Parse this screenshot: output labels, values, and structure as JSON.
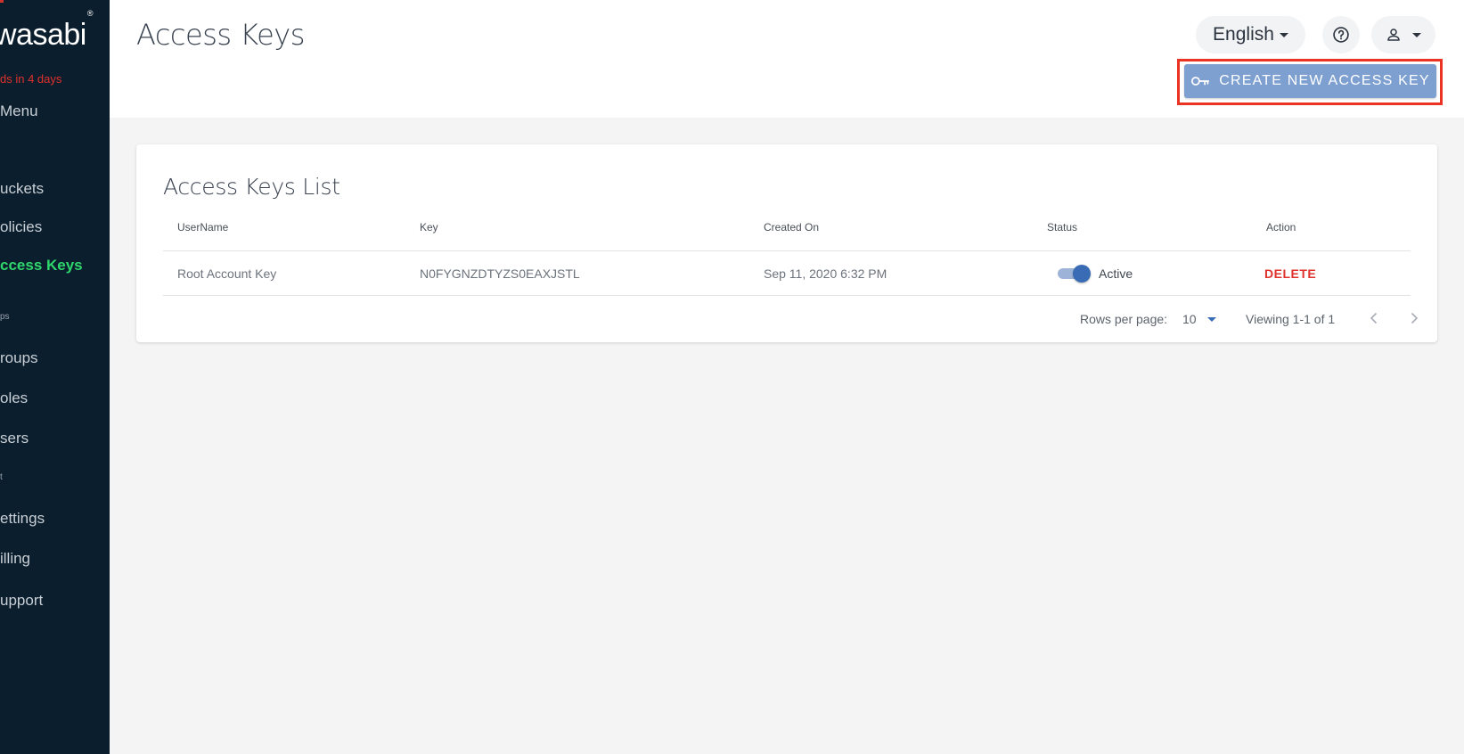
{
  "sidebar": {
    "logo": "wasabi",
    "logo_mark": "®",
    "trial_notice": "ds in 4 days",
    "menu_label": "Menu",
    "items": [
      {
        "label": "Buckets",
        "visible_text": "uckets"
      },
      {
        "label": "Policies",
        "visible_text": "olicies"
      },
      {
        "label": "Access Keys",
        "visible_text": "ccess Keys",
        "active": true
      },
      {
        "label": "Groups",
        "visible_text": "roups"
      },
      {
        "label": "Roles",
        "visible_text": "oles"
      },
      {
        "label": "Users",
        "visible_text": "sers"
      },
      {
        "label": "Settings",
        "visible_text": "ettings"
      },
      {
        "label": "Billing",
        "visible_text": "illing"
      },
      {
        "label": "Support",
        "visible_text": "upport"
      }
    ],
    "sections": [
      "ps",
      "t"
    ]
  },
  "header": {
    "title": "Access Keys",
    "language": "English",
    "help_icon": "help-circle-icon",
    "user_icon": "person-icon",
    "create_button": "CREATE NEW ACCESS KEY",
    "create_icon": "key-icon"
  },
  "card": {
    "title": "Access Keys List",
    "columns": [
      "UserName",
      "Key",
      "Created On",
      "Status",
      "Action"
    ],
    "rows": [
      {
        "username": "Root Account Key",
        "key": "N0FYGNZDTYZS0EAXJSTL",
        "created_on": "Sep 11, 2020 6:32 PM",
        "status": "Active",
        "enabled": true,
        "action": "DELETE"
      }
    ],
    "pagination": {
      "rows_per_page_label": "Rows per page:",
      "rows_per_page": "10",
      "viewing": "Viewing 1-1 of 1"
    }
  },
  "colors": {
    "sidebar_bg": "#0b1e2d",
    "active_nav": "#2fd66b",
    "primary_button": "#7ea0d0",
    "toggle_on": "#3a6cb5",
    "danger": "#e0322c",
    "highlight_outline": "#ea3323"
  }
}
